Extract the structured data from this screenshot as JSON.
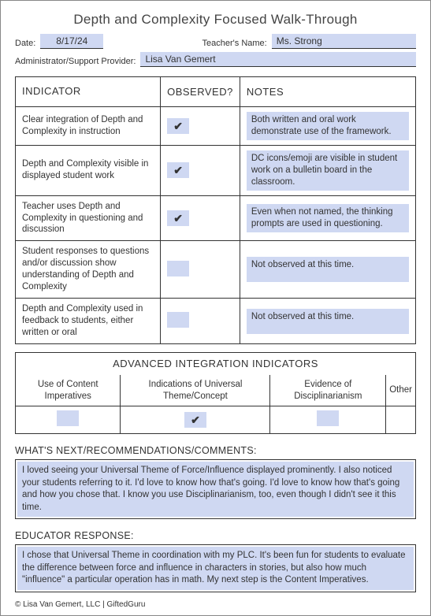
{
  "title": "Depth and  Complexity Focused Walk-Through",
  "header": {
    "date_label": "Date:",
    "date_value": "8/17/24",
    "teacher_label": "Teacher's Name:",
    "teacher_value": "Ms. Strong",
    "admin_label": "Administrator/Support Provider:",
    "admin_value": "Lisa Van Gemert"
  },
  "columns": {
    "indicator": "INDICATOR",
    "observed": "OBSERVED?",
    "notes": "NOTES"
  },
  "rows": [
    {
      "indicator": "Clear integration of Depth and Complexity in instruction",
      "observed": "✔",
      "notes": "Both written and oral work demonstrate use of the framework."
    },
    {
      "indicator": "Depth and Complexity visible in displayed student work",
      "observed": "✔",
      "notes": "DC icons/emoji are visible in student work on a bulletin board in the classroom."
    },
    {
      "indicator": "Teacher uses Depth and Complexity in questioning and discussion",
      "observed": "✔",
      "notes": "Even when not named, the thinking prompts are used in questioning."
    },
    {
      "indicator": "Student responses to questions and/or discussion show understanding of Depth and Complexity",
      "observed": "",
      "notes": "Not observed at this time."
    },
    {
      "indicator": "Depth and Complexity used in feedback to students, either written or oral",
      "observed": "",
      "notes": "Not observed at this time."
    }
  ],
  "advanced": {
    "title": "ADVANCED INTEGRATION INDICATORS",
    "cols": [
      {
        "label": "Use of Content Imperatives",
        "check": ""
      },
      {
        "label": "Indications of Universal Theme/Concept",
        "check": "✔"
      },
      {
        "label": "Evidence of Disciplinarianism",
        "check": ""
      },
      {
        "label": "Other",
        "check": ""
      }
    ]
  },
  "next": {
    "label": "WHAT'S NEXT/RECOMMENDATIONS/COMMENTS:",
    "text": "I loved seeing your Universal Theme of Force/Influence displayed prominently. I also noticed your students referring to it. I'd love to know how that's going. I'd love to know how that's going and how you chose that. I know you use Disciplinarianism, too, even though I didn't see it this time."
  },
  "response": {
    "label": "EDUCATOR RESPONSE:",
    "text": "I chose that Universal Theme in coordination with my PLC. It's been fun for students to evaluate the difference between force and influence in characters in stories, but also how much \"influence\" a particular operation has in math. My next step is the Content Imperatives."
  },
  "footer": "© Lisa Van Gemert, LLC | GiftedGuru"
}
